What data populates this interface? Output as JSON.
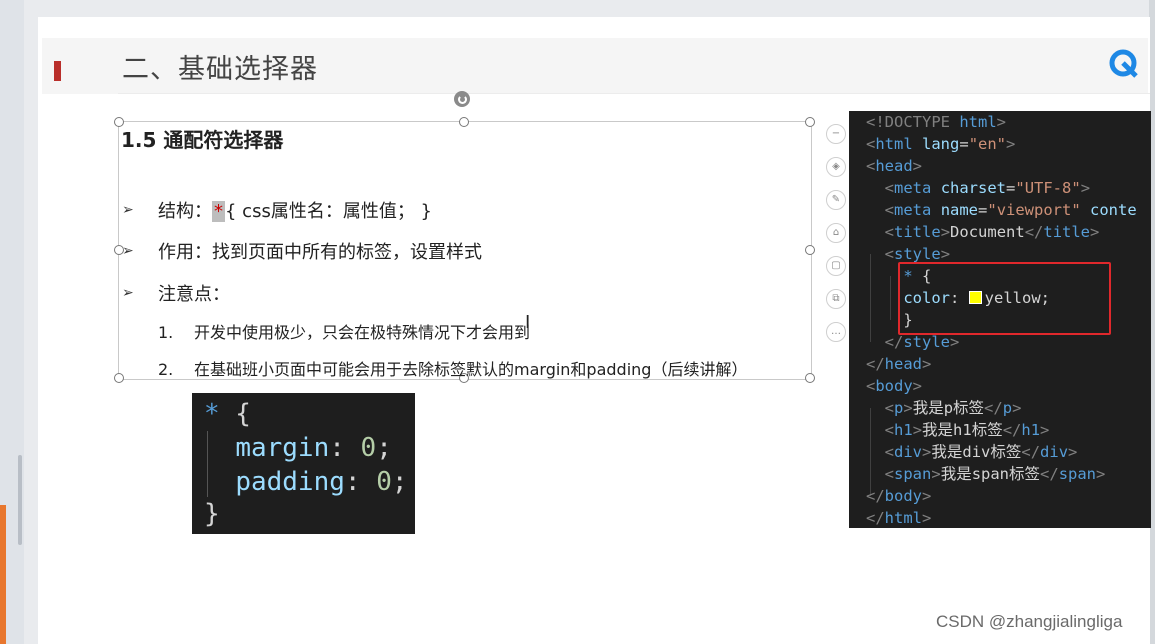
{
  "slide": {
    "title": "二、基础选择器",
    "section_heading": "1.5 通配符选择器",
    "bullets": [
      {
        "prefix": "结构：",
        "highlight": "*",
        "suffix": "{ css属性名：属性值； }"
      },
      {
        "text": "作用：找到页面中所有的标签，设置样式"
      },
      {
        "text": "注意点："
      }
    ],
    "numbered": [
      {
        "num": "1.",
        "text": "开发中使用极少，只会在极特殊情况下才会用到"
      },
      {
        "num": "2.",
        "text": "在基础班小页面中可能会用于去除标签默认的margin和padding（后续讲解）"
      }
    ]
  },
  "code_snippet": {
    "line1_star": "*",
    "line1_brace": " {",
    "line2_prop": "margin",
    "line2_val": "0",
    "line3_prop": "padding",
    "line3_val": "0",
    "line4": "}"
  },
  "editor": {
    "l1": {
      "open": "<!DOCTYPE",
      "kw": " html",
      "close": ">"
    },
    "l2": {
      "tag": "html",
      "attr": "lang",
      "val": "\"en\""
    },
    "l3": {
      "tag": "head"
    },
    "l4": {
      "tag": "meta",
      "attr": "charset",
      "val": "\"UTF-8\""
    },
    "l5": {
      "tag": "meta",
      "attr": "name",
      "val": "\"viewport\"",
      "more": " conte"
    },
    "l6": {
      "tag": "title",
      "text": "Document"
    },
    "l7": {
      "tag": "style"
    },
    "l8": {
      "sel": "*",
      "brace": " {"
    },
    "l9": {
      "prop": "color",
      "val": "yellow;"
    },
    "l10": {
      "brace": "}"
    },
    "l11": {
      "tag": "style"
    },
    "l12": {
      "tag": "head"
    },
    "l13": {
      "tag": "body"
    },
    "l14": {
      "tag": "p",
      "text": "我是p标签"
    },
    "l15": {
      "tag": "h1",
      "text": "我是h1标签"
    },
    "l16": {
      "tag": "div",
      "text": "我是div标签"
    },
    "l17": {
      "tag": "span",
      "text": "我是span标签"
    },
    "l18": {
      "tag": "body"
    },
    "l19": {
      "tag": "html"
    }
  },
  "watermark": "CSDN @zhangjialingliga",
  "colors": {
    "accent_red": "#b92e2a",
    "highlight_box": "#e0282c",
    "swatch": "#ffff00"
  }
}
